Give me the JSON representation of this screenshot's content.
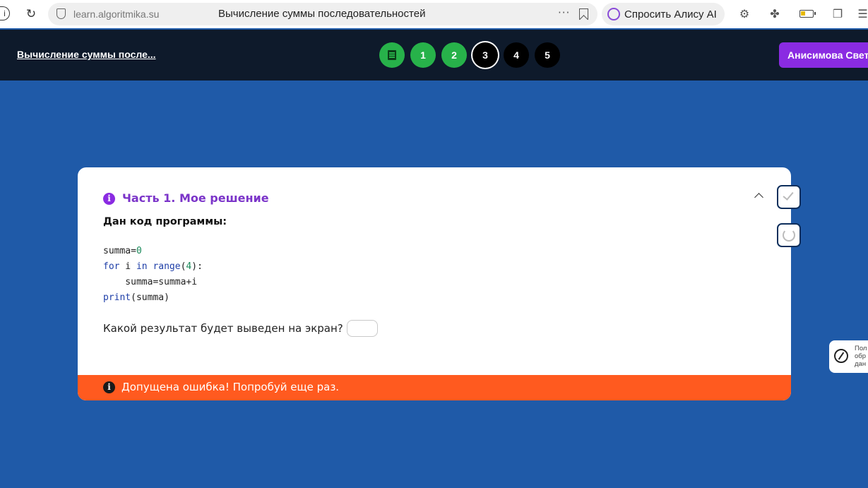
{
  "browser": {
    "url": "learn.algoritmika.su",
    "tab_title": "Вычисление суммы последовательностей",
    "more": "···",
    "alice_label": "Спросить Алису AI"
  },
  "header": {
    "lesson_title": "Вычисление суммы после...",
    "steps": [
      "1",
      "2",
      "3",
      "4",
      "5"
    ],
    "user_name": "Анисимова Свет"
  },
  "card": {
    "part_title": "Часть 1. Мое решение",
    "given_label": "Дан код программы:",
    "code": {
      "line1_a": "summa=",
      "line1_b": "0",
      "line2_kw1": "for",
      "line2_a": " i ",
      "line2_kw2": "in",
      "line2_sp": " ",
      "line2_kw3": "range",
      "line2_b": "(",
      "line2_num": "4",
      "line2_c": "):",
      "line3": "    summa=summa+i",
      "line4_kw": "print",
      "line4_a": "(summa)"
    },
    "question": "Какой результат будет выведен на экран?",
    "answer_value": "",
    "error_message": "Допущена ошибка! Попробуй еще раз."
  },
  "edge_widget": {
    "text": "Пол обр дан"
  },
  "colors": {
    "page_bg": "#1f5aa8",
    "header_bg": "#0e1a2b",
    "step_done": "#27b24a",
    "accent_purple": "#8a2be2",
    "error_orange": "#ff5a1f"
  }
}
